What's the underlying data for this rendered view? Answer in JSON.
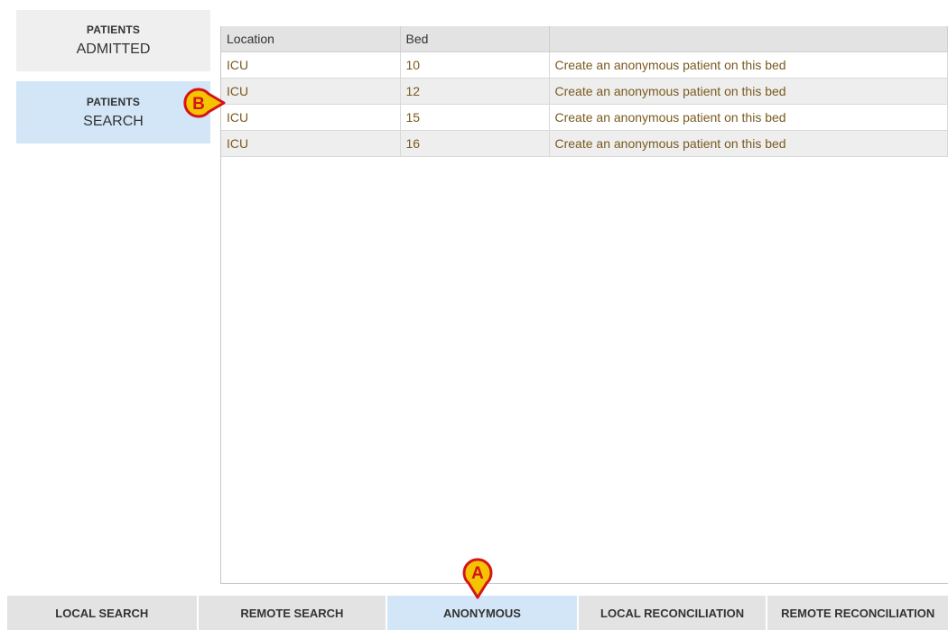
{
  "sidebar": {
    "admitted": {
      "caption": "PATIENTS",
      "label": "ADMITTED"
    },
    "search": {
      "caption": "PATIENTS",
      "label": "SEARCH"
    }
  },
  "table": {
    "columns": [
      "Location",
      "Bed",
      ""
    ],
    "rows": [
      {
        "location": "ICU",
        "bed": "10",
        "action": "Create an anonymous patient on this bed"
      },
      {
        "location": "ICU",
        "bed": "12",
        "action": "Create an anonymous patient on this bed"
      },
      {
        "location": "ICU",
        "bed": "15",
        "action": "Create an anonymous patient on this bed"
      },
      {
        "location": "ICU",
        "bed": "16",
        "action": "Create an anonymous patient on this bed"
      }
    ]
  },
  "tabs": [
    {
      "label": "LOCAL SEARCH",
      "active": false
    },
    {
      "label": "REMOTE SEARCH",
      "active": false
    },
    {
      "label": "ANONYMOUS",
      "active": true
    },
    {
      "label": "LOCAL RECONCILIATION",
      "active": false
    },
    {
      "label": "REMOTE RECONCILIATION",
      "active": false
    }
  ],
  "callouts": {
    "a": "A",
    "b": "B"
  },
  "colors": {
    "active_tab": "#d2e6f7",
    "inactive_tab": "#e3e3e3",
    "cell_text": "#7a5a1e",
    "callout_fill": "#f5c400",
    "callout_stroke": "#d4141c"
  }
}
